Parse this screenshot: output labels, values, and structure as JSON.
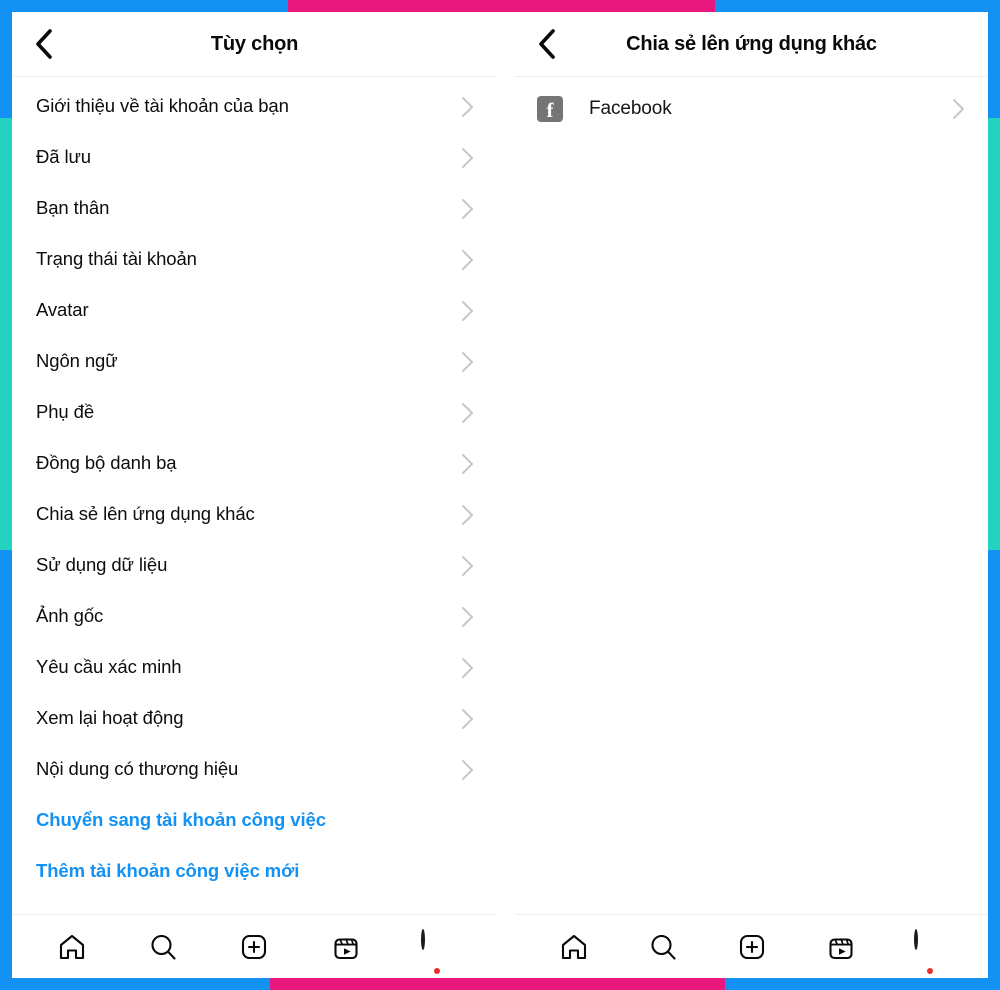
{
  "frame": {
    "blue": "#1392f3",
    "pink": "#e8187f",
    "teal": "#23d3c0"
  },
  "accent_blue": "#1392f3",
  "left_panel": {
    "header": {
      "back_icon": "chevron-left-icon",
      "title": "Tùy chọn"
    },
    "items": [
      {
        "label": "Giới thiệu về tài khoản của bạn",
        "type": "nav"
      },
      {
        "label": "Đã lưu",
        "type": "nav"
      },
      {
        "label": "Bạn thân",
        "type": "nav"
      },
      {
        "label": "Trạng thái tài khoản",
        "type": "nav"
      },
      {
        "label": "Avatar",
        "type": "nav"
      },
      {
        "label": "Ngôn ngữ",
        "type": "nav"
      },
      {
        "label": "Phụ đề",
        "type": "nav"
      },
      {
        "label": "Đồng bộ danh bạ",
        "type": "nav"
      },
      {
        "label": "Chia sẻ lên ứng dụng khác",
        "type": "nav"
      },
      {
        "label": "Sử dụng dữ liệu",
        "type": "nav"
      },
      {
        "label": "Ảnh gốc",
        "type": "nav"
      },
      {
        "label": "Yêu cầu xác minh",
        "type": "nav"
      },
      {
        "label": "Xem lại hoạt động",
        "type": "nav"
      },
      {
        "label": "Nội dung có thương hiệu",
        "type": "nav"
      },
      {
        "label": "Chuyển sang tài khoản công việc",
        "type": "link"
      },
      {
        "label": "Thêm tài khoản công việc mới",
        "type": "link"
      }
    ]
  },
  "right_panel": {
    "header": {
      "back_icon": "chevron-left-icon",
      "title": "Chia sẻ lên ứng dụng khác"
    },
    "items": [
      {
        "label": "Facebook",
        "icon": "facebook-icon",
        "type": "app"
      }
    ]
  },
  "bottom_nav": {
    "items": [
      {
        "name": "home",
        "icon": "home-icon"
      },
      {
        "name": "search",
        "icon": "search-icon"
      },
      {
        "name": "create",
        "icon": "plus-square-icon"
      },
      {
        "name": "reels",
        "icon": "reels-icon"
      },
      {
        "name": "profile",
        "icon": "avatar-icon",
        "badge": true
      }
    ]
  }
}
